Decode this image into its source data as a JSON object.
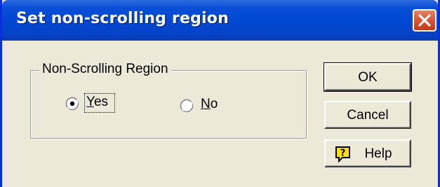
{
  "window": {
    "title": "Set non-scrolling region"
  },
  "group": {
    "label": "Non-Scrolling Region",
    "options": [
      {
        "label_prefix": "",
        "mnemonic": "Y",
        "label_rest": "es",
        "checked": true
      },
      {
        "label_prefix": "",
        "mnemonic": "N",
        "label_rest": "o",
        "checked": false
      }
    ]
  },
  "buttons": {
    "ok": "OK",
    "cancel": "Cancel",
    "help": "Help"
  },
  "icons": {
    "close": "close-icon",
    "help": "help-icon"
  },
  "colors": {
    "titlebar": "#0048d3",
    "close_button": "#dc5738",
    "dialog_face": "#ece9d8",
    "help_icon_fill": "#ffe000"
  }
}
